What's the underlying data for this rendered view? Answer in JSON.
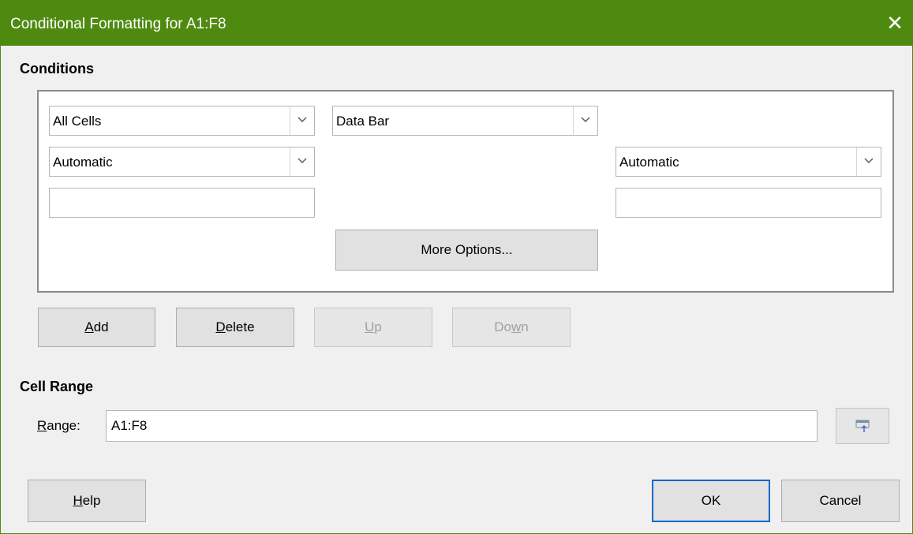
{
  "window": {
    "title": "Conditional Formatting for A1:F8",
    "close_glyph": "✕"
  },
  "conditions": {
    "section_label": "Conditions",
    "cell_condition": "All Cells",
    "format_type": "Data Bar",
    "min_type": "Automatic",
    "max_type": "Automatic",
    "min_value": "",
    "max_value": "",
    "more_options_label": "More Options..."
  },
  "condition_buttons": {
    "add": {
      "mnemonic": "A",
      "rest": "dd"
    },
    "delete": {
      "mnemonic": "D",
      "rest": "elete"
    },
    "up": {
      "mnemonic": "U",
      "rest": "p",
      "enabled": false
    },
    "down": {
      "prefix": "Do",
      "mnemonic": "w",
      "rest": "n",
      "enabled": false
    }
  },
  "cell_range": {
    "section_label": "Cell Range",
    "range_label_mnemonic": "R",
    "range_label_rest": "ange:",
    "range_value": "A1:F8",
    "shrink_icon": "shrink-dialog-icon"
  },
  "footer": {
    "help": {
      "mnemonic": "H",
      "rest": "elp"
    },
    "ok_label": "OK",
    "cancel_label": "Cancel"
  },
  "colors": {
    "titlebar": "#4e8a10",
    "default_button_border": "#0a68c8"
  }
}
